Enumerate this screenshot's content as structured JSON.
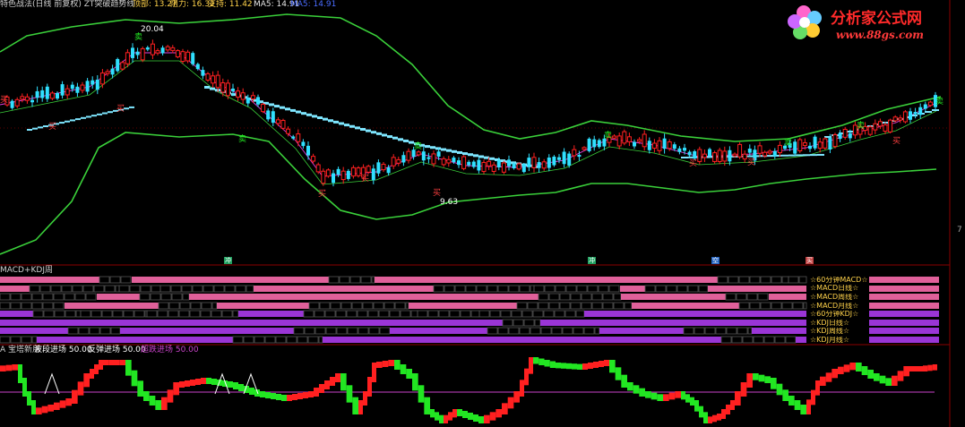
{
  "header": {
    "title": "特色战法(日线 前复权) ZT突破趋势线",
    "items": [
      {
        "label": "顶部: 13.27",
        "color": "#ffd24a"
      },
      {
        "label": "阻力: 16.32",
        "color": "#ffd24a"
      },
      {
        "label": "支持: 11.42",
        "color": "#ffd24a"
      },
      {
        "label": "MA5: 14.91",
        "color": "#e6e6e6"
      },
      {
        "label": "MA5: 14.91",
        "color": "#4a6cff"
      }
    ]
  },
  "price_annotations": {
    "high": "20.04",
    "low": "9.63",
    "axis_marker": "7"
  },
  "logo": {
    "main": "分析家公式网",
    "url": "www.88gs.com"
  },
  "signal_tags": [
    "冲",
    "冲",
    "买",
    "卖",
    "空"
  ],
  "buy_label": "买",
  "sell_label": "卖",
  "stripe_panel": {
    "title": "MACD+KDJ周",
    "rows": [
      {
        "label": "☆60分钟MACD☆",
        "color": "#e0609a"
      },
      {
        "label": "☆MACD日线☆",
        "color": "#e0609a"
      },
      {
        "label": "☆MACD周线☆",
        "color": "#e0609a"
      },
      {
        "label": "☆MACD月线☆",
        "color": "#e0609a"
      },
      {
        "label": "☆60分钟KDJ☆",
        "color": "#9a35d6"
      },
      {
        "label": "☆KDJ日线☆",
        "color": "#9a35d6"
      },
      {
        "label": "☆KDJ周线☆",
        "color": "#9a35d6"
      },
      {
        "label": "☆KDJ月线☆",
        "color": "#9a35d6"
      }
    ]
  },
  "indicator_panel": {
    "items": [
      {
        "label": "A 宝塔新用",
        "color": "#cfcfcf"
      },
      {
        "label": "波段进场 50.00",
        "color": "#ffffff"
      },
      {
        "label": "反弹进场 50.00",
        "color": "#ffffff"
      },
      {
        "label": "超跌进场 50.00",
        "color": "#cc44cc"
      }
    ],
    "threshold": 50
  },
  "colors": {
    "up": "#ff2020",
    "down": "#30e0ff",
    "band": "#3ad03a",
    "ma": "#e040e0",
    "stair": "#7ee6ff",
    "tower_up": "#ff2020",
    "tower_down": "#22e622"
  }
}
